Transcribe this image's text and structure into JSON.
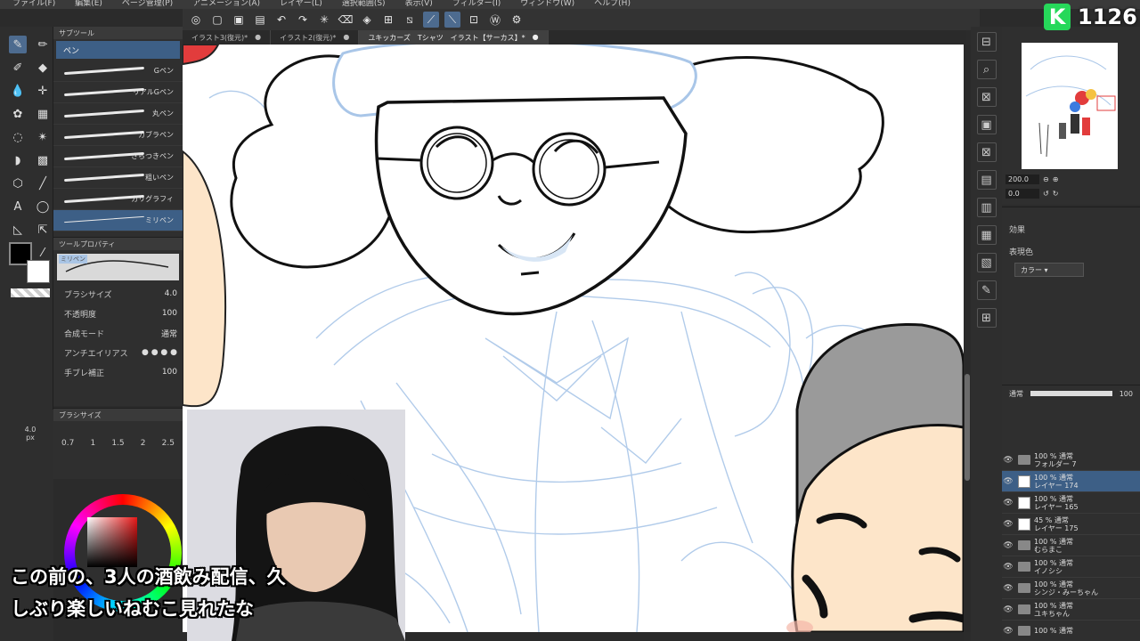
{
  "menu": [
    "ファイル(F)",
    "編集(E)",
    "ページ管理(P)",
    "アニメーション(A)",
    "レイヤー(L)",
    "選択範囲(S)",
    "表示(V)",
    "フィルター(I)",
    "ウィンドウ(W)",
    "ヘルプ(H)"
  ],
  "tabs": [
    {
      "label": "イラスト3(復元)*",
      "close": "●"
    },
    {
      "label": "イラスト2(復元)*",
      "close": "●"
    },
    {
      "label": "ユキッカーズ　Tシャツ　イラスト【サーカス】*",
      "close": "●"
    }
  ],
  "subtool": {
    "panel_title": "サブツール",
    "header": "ペン",
    "brushes": [
      "Gペン",
      "リアルGペン",
      "丸ペン",
      "カブラペン",
      "さらつきペン",
      "粗いペン",
      "カリグラフィ",
      "ミリペン"
    ]
  },
  "toolprop": {
    "panel_title": "ツールプロパティ",
    "preview_label": "ミリペン",
    "rows": [
      {
        "label": "ブラシサイズ",
        "value": "4.0"
      },
      {
        "label": "不透明度",
        "value": "100"
      },
      {
        "label": "合成モード",
        "value": "通常"
      },
      {
        "label": "アンチエイリアス",
        "value": ""
      },
      {
        "label": "手ブレ補正",
        "value": "100"
      }
    ]
  },
  "brushsize": {
    "panel_title": "ブラシサイズ",
    "sizes": [
      "0.7",
      "1",
      "1.5",
      "2",
      "2.5"
    ],
    "indicator": "4.0",
    "indicator_unit": "px"
  },
  "navigator": {
    "zoom": "200.0",
    "rotate": "0.0"
  },
  "effect": {
    "title": "効果",
    "color_label": "表現色",
    "color_value": "カラー"
  },
  "layers": {
    "blend": "通常",
    "opacity": "100",
    "items": [
      {
        "pct": "100 % 通常",
        "name": "フォルダー 7",
        "type": "folder",
        "selected": false
      },
      {
        "pct": "100 % 通常",
        "name": "レイヤー 174",
        "type": "layer",
        "selected": true
      },
      {
        "pct": "100 % 通常",
        "name": "レイヤー 165",
        "type": "layer",
        "selected": false
      },
      {
        "pct": "45 % 通常",
        "name": "レイヤー 175",
        "type": "layer",
        "selected": false
      },
      {
        "pct": "100 % 通常",
        "name": "むらまこ",
        "type": "folder",
        "selected": false
      },
      {
        "pct": "100 % 通常",
        "name": "イノシシ",
        "type": "folder",
        "selected": false
      },
      {
        "pct": "100 % 通常",
        "name": "シンジ・みーちゃん",
        "type": "folder",
        "selected": false
      },
      {
        "pct": "100 % 通常",
        "name": "ユキちゃん",
        "type": "folder",
        "selected": false
      },
      {
        "pct": "100 % 通常",
        "name": "",
        "type": "folder",
        "selected": false
      }
    ]
  },
  "stream": {
    "viewer_count": "1126",
    "badge_letter": "K"
  },
  "caption": {
    "line1": "この前の、3人の酒飲み配信、久",
    "line2": "しぶり楽しいねむこ見れたな"
  },
  "colors": {
    "accent": "#3d5f86",
    "sketch": "#a9c6e8",
    "skin": "#fde5c9",
    "hat": "#9a9a9a"
  }
}
